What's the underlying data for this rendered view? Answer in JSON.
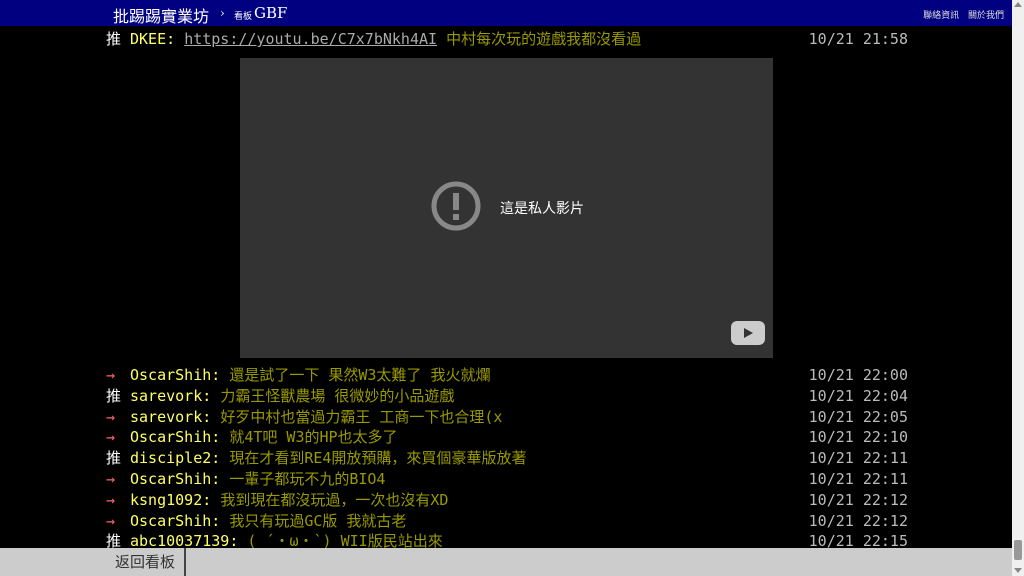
{
  "header": {
    "site_title": "批踢踢實業坊",
    "separator": "›",
    "board_label": "看板",
    "board_name": "GBF",
    "links": [
      "聯絡資訊",
      "關於我們"
    ]
  },
  "pushes_before": [
    {
      "tag": "推",
      "user": "DKEE",
      "url": "https://youtu.be/C7x7bNkh4AI",
      "text": " 中村每次玩的遊戲我都沒看過",
      "time": "10/21 21:58"
    }
  ],
  "video": {
    "message": "這是私人影片",
    "icons": [
      "alert-icon",
      "youtube-logo-icon"
    ]
  },
  "pushes_after": [
    {
      "tag": "→",
      "user": "OscarShih",
      "text": "還是試了一下 果然W3太難了 我火就爛",
      "time": "10/21 22:00"
    },
    {
      "tag": "推",
      "user": "sarevork",
      "text": "力霸王怪獸農場 很微妙的小品遊戲",
      "time": "10/21 22:04"
    },
    {
      "tag": "→",
      "user": "sarevork",
      "text": "好歹中村也當過力霸王 工商一下也合理(x",
      "time": "10/21 22:05"
    },
    {
      "tag": "→",
      "user": "OscarShih",
      "text": "就4T吧 W3的HP也太多了",
      "time": "10/21 22:10"
    },
    {
      "tag": "推",
      "user": "disciple2",
      "text": "現在才看到RE4開放預購，來買個豪華版放著",
      "time": "10/21 22:11"
    },
    {
      "tag": "→",
      "user": "OscarShih",
      "text": "一輩子都玩不九的BIO4",
      "time": "10/21 22:11"
    },
    {
      "tag": "→",
      "user": "ksng1092",
      "text": "我到現在都沒玩過，一次也沒有XD",
      "time": "10/21 22:12"
    },
    {
      "tag": "→",
      "user": "OscarShih",
      "text": "我只有玩過GC版 我就古老",
      "time": "10/21 22:12"
    },
    {
      "tag": "推",
      "user": "abc10037139",
      "text": "( ´・ω・`) WII版民站出來",
      "time": "10/21 22:15"
    }
  ],
  "footer": {
    "back_label": "返回看板"
  },
  "colors": {
    "header_bg": "#000080",
    "push_user": "#ffff66",
    "push_text": "#999900",
    "arrow": "#ff6666",
    "bottom_bar": "#cccccc"
  }
}
